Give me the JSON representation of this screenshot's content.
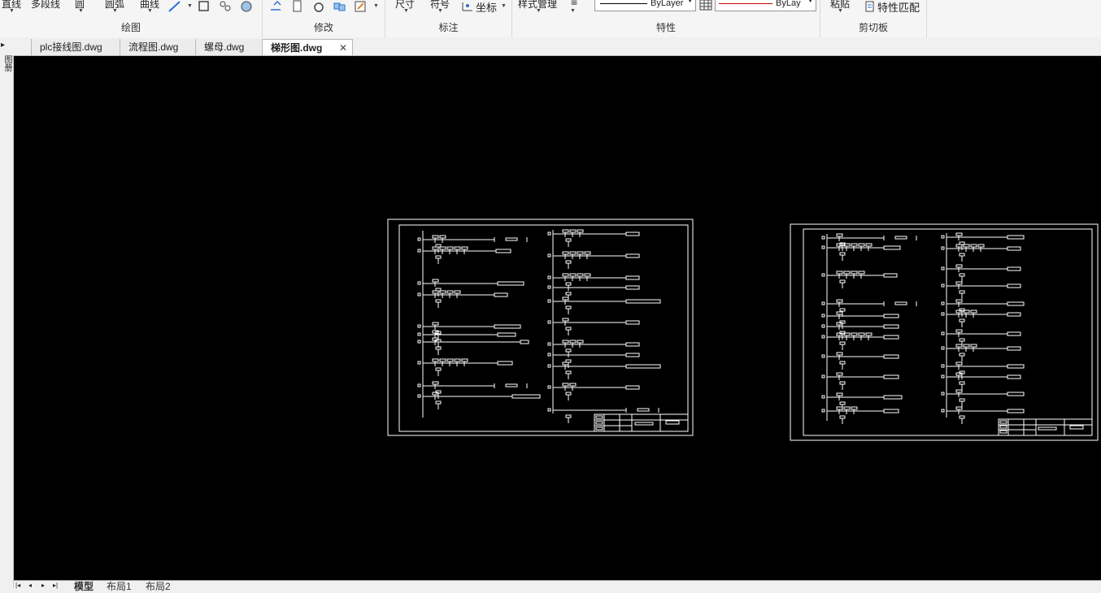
{
  "ribbon": {
    "draw_tools": [
      "直线",
      "多段线",
      "圆",
      "圆弧",
      "曲线"
    ],
    "draw_group": "绘图",
    "modify_group": "修改",
    "annotate_tools": [
      "尺寸",
      "符号",
      "坐标"
    ],
    "annotate_group": "标注",
    "style_manager": "样式管理",
    "layer_linetype": "ByLayer",
    "layer_color": "ByLay",
    "properties_group": "特性",
    "paste": "粘贴",
    "match_properties": "特性匹配",
    "clipboard_group": "剪切板"
  },
  "tabs": [
    {
      "label": "plc接线图.dwg"
    },
    {
      "label": "流程图.dwg"
    },
    {
      "label": "螺母.dwg"
    },
    {
      "label": "梯形图.dwg",
      "active": true
    }
  ],
  "sidebar": {
    "label": "图册"
  },
  "layout_tabs": [
    "模型",
    "布局1",
    "布局2"
  ],
  "colors": {
    "canvas": "#000000",
    "drawing": "#ffffff",
    "layer_color": "#cc0000"
  }
}
